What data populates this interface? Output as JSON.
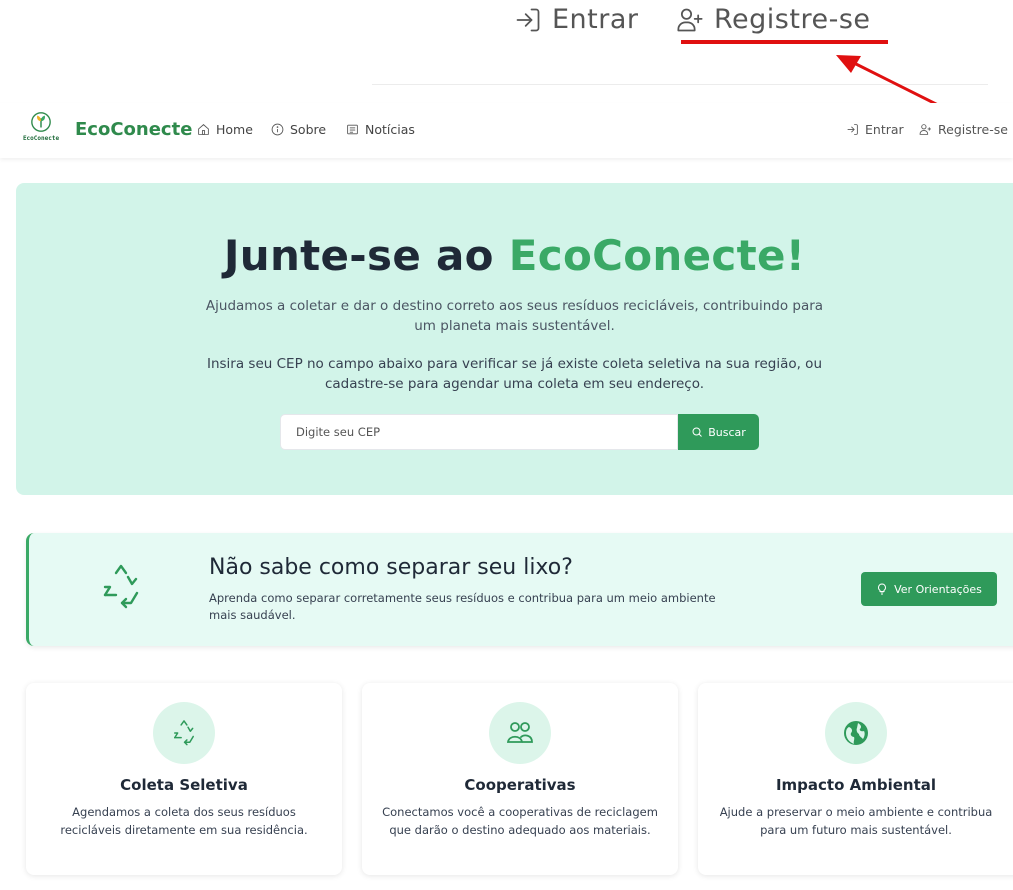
{
  "zoom": {
    "entrar_label": "Entrar",
    "registre_label": "Registre-se",
    "annotation_color": "#e01010"
  },
  "navbar": {
    "logo_small_text": "EcoConecte",
    "brand": "EcoConecte",
    "links": [
      {
        "label": "Home",
        "icon": "home-icon"
      },
      {
        "label": "Sobre",
        "icon": "info-icon"
      },
      {
        "label": "Notícias",
        "icon": "newspaper-icon"
      }
    ],
    "entrar_label": "Entrar",
    "registre_label": "Registre-se"
  },
  "hero": {
    "title_prefix": "Junte-se ao ",
    "title_accent": "EcoConecte!",
    "paragraph1": "Ajudamos a coletar e dar o destino correto aos seus resíduos recicláveis, contribuindo para um planeta mais sustentável.",
    "paragraph2": "Insira seu CEP no campo abaixo para verificar se já existe coleta seletiva na sua região, ou cadastre-se para agendar uma coleta em seu endereço.",
    "cep_placeholder": "Digite seu CEP",
    "search_label": "Buscar",
    "background": "#d2f4e9",
    "accent": "#3aa966"
  },
  "tip": {
    "title": "Não sabe como separar seu lixo?",
    "description": "Aprenda como separar corretamente seus resíduos e contribua para um meio ambiente mais saudável.",
    "button_label": "Ver Orientações"
  },
  "features": [
    {
      "title": "Coleta Seletiva",
      "description": "Agendamos a coleta dos seus resíduos recicláveis diretamente em sua residência.",
      "icon": "recycle-icon"
    },
    {
      "title": "Cooperativas",
      "description": "Conectamos você a cooperativas de reciclagem que darão o destino adequado aos materiais.",
      "icon": "users-icon"
    },
    {
      "title": "Impacto Ambiental",
      "description": "Ajude a preservar o meio ambiente e contribua para um futuro mais sustentável.",
      "icon": "globe-icon"
    }
  ]
}
